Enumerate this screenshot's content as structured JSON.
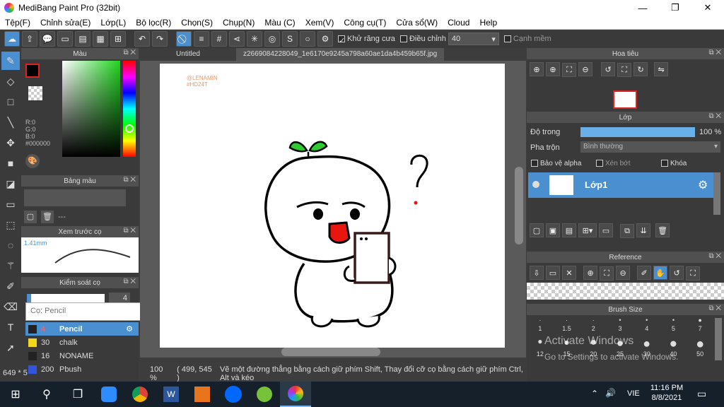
{
  "window": {
    "title": "MediBang Paint Pro (32bit)"
  },
  "menu": [
    "Tệp(F)",
    "Chỉnh sửa(E)",
    "Lớp(L)",
    "Bộ lọc(R)",
    "Chọn(S)",
    "Chụp(N)",
    "Màu (C)",
    "Xem(V)",
    "Công cụ(T)",
    "Cửa sổ(W)",
    "Cloud",
    "Help"
  ],
  "toolbar": {
    "antialias_label": "Khử răng cưa",
    "adjust_label": "Điều chỉnh",
    "adjust_value": "40",
    "snap_label": "Cạnh mềm"
  },
  "color_panel": {
    "title": "Màu",
    "r": "R:0",
    "g": "G:0",
    "b": "B:0",
    "hex": "#000000"
  },
  "palette_panel": {
    "title": "Bảng màu",
    "dash": "---"
  },
  "brush_preview": {
    "title": "Xem trước cọ",
    "size": "1.41mm"
  },
  "brush_control": {
    "title": "Kiểm soát cọ",
    "size_value": "4"
  },
  "brush_list": {
    "search_placeholder": "Cọ: Pencil",
    "items": [
      {
        "size": "4",
        "name": "Pencil"
      },
      {
        "size": "30",
        "name": "chalk"
      },
      {
        "size": "16",
        "name": "NONAME"
      },
      {
        "size": "200",
        "name": "Pbush"
      }
    ]
  },
  "tabs": [
    {
      "label": "Untitled"
    },
    {
      "label": "z2669084228049_1e6170e9245a798a60ae1da4b459b65f.jpg"
    }
  ],
  "canvas": {
    "watermark1": "@LENAMIN",
    "watermark2": "#HD24T"
  },
  "status": {
    "zoom": "100 %",
    "coords": "( 499, 545 )",
    "hint": "Vẽ một đường thẳng bằng cách giữ phím Shift, Thay đổi cỡ cọ bằng cách giữ phím Ctrl, Alt và kéo",
    "left_coords": "649 * 5"
  },
  "navigator": {
    "title": "Hoa tiêu"
  },
  "layer_panel": {
    "title": "Lớp",
    "opacity_label": "Độ trong",
    "opacity_value": "100 %",
    "opacity": 1.0,
    "blend_label": "Pha trộn",
    "blend_value": "Bình thường",
    "protect_alpha": "Bảo vệ alpha",
    "clip": "Xén bớt",
    "lock": "Khóa",
    "layer_name": "Lớp1"
  },
  "reference": {
    "title": "Reference"
  },
  "brush_size": {
    "title": "Brush Size",
    "row1": [
      "1",
      "1.5",
      "2",
      "3",
      "4",
      "5",
      "7"
    ],
    "row2": [
      "12",
      "15",
      "20",
      "25",
      "30",
      "40",
      "50"
    ]
  },
  "activate": {
    "line1": "Activate Windows",
    "line2": "Go to Settings to activate Windows."
  },
  "taskbar": {
    "time": "11:16 PM",
    "date": "8/8/2021",
    "lang": "VIE"
  },
  "colors": {
    "accent": "#4a8fd0",
    "panel": "#3a3a3a"
  }
}
